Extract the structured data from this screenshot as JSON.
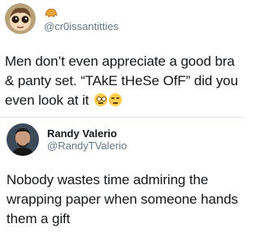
{
  "tweet1": {
    "handle": "@cr0issantitties",
    "text_line1": "Men don’t even appreciate a good bra",
    "text_line2": "& panty set. “TAkE tHeSe OfF” did you",
    "text_line3": "even look at it",
    "emojis": [
      "face-with-rolling-eyes-emoji",
      "unamused-face-emoji"
    ]
  },
  "tweet2": {
    "name": "Randy Valerio",
    "handle": "@RandyTValerio",
    "text_line1": "Nobody wastes time admiring the",
    "text_line2": "wrapping paper when someone hands",
    "text_line3": "them a gift"
  }
}
